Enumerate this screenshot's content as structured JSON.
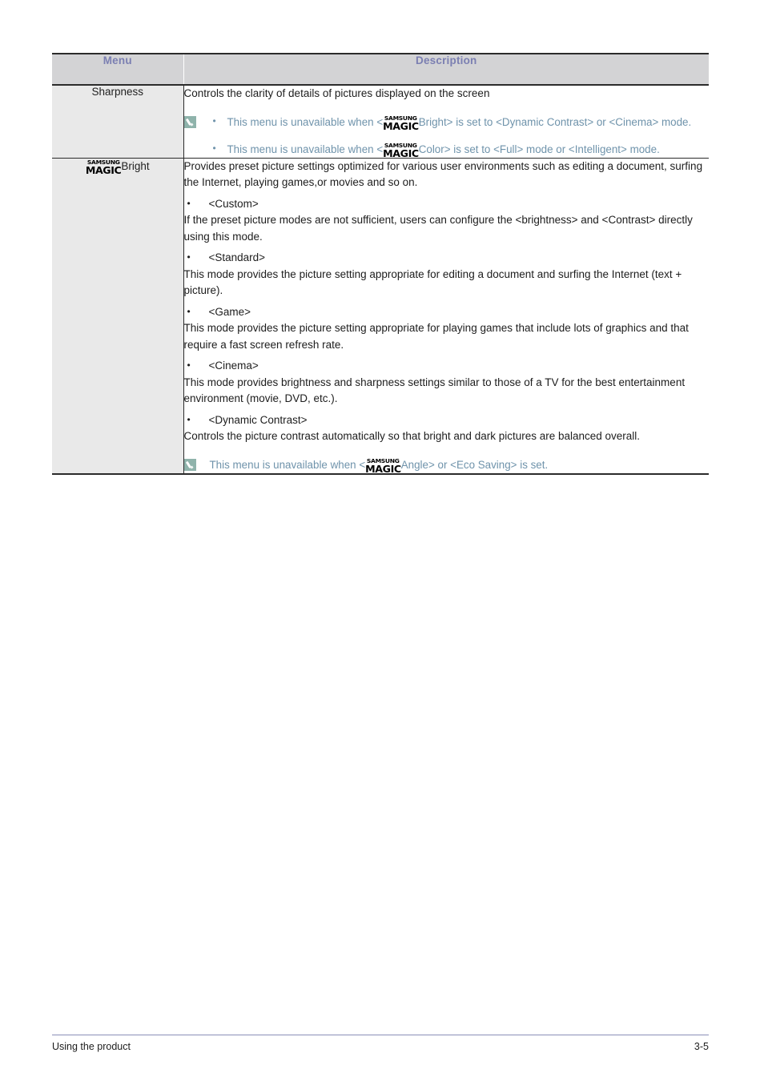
{
  "table": {
    "headers": {
      "menu": "Menu",
      "description": "Description"
    },
    "rows": [
      {
        "menu_label": "Sharpness",
        "menu_has_logo": false,
        "intro": "Controls the clarity of details of pictures displayed on the screen",
        "note_bullets": [
          {
            "pre": "This menu is unavailable when <",
            "logo": {
              "top": "SAMSUNG",
              "bottom": "MAGIC"
            },
            "post": "Bright> is set to <Dynamic Contrast> or <Cinema> mode."
          },
          {
            "pre": "This menu is unavailable when <",
            "logo": {
              "top": "SAMSUNG",
              "bottom": "MAGIC"
            },
            "post": "Color> is set to <Full> mode or <Intelligent> mode."
          }
        ]
      },
      {
        "menu_label": "Bright",
        "menu_has_logo": true,
        "menu_logo": {
          "top": "SAMSUNG",
          "bottom": "MAGIC"
        },
        "intro": "Provides preset picture settings optimized for various user environments such as editing a document, surfing the Internet, playing games,or movies and so on.",
        "items": [
          {
            "bullet": "<Custom>",
            "body": "If the preset picture modes are not sufficient, users can configure the <brightness> and <Contrast> directly using this mode."
          },
          {
            "bullet": "<Standard>",
            "body": " This mode provides the picture setting appropriate for editing a document and surfing the Internet (text + picture)."
          },
          {
            "bullet": "<Game>",
            "body": "This mode provides the picture setting appropriate for playing games that include lots of graphics and that require a fast screen refresh rate."
          },
          {
            "bullet": "<Cinema>",
            "body": "This mode provides brightness and sharpness settings similar to those of a TV for the best entertainment environment (movie, DVD, etc.)."
          },
          {
            "bullet": "<Dynamic Contrast>",
            "body": "Controls the picture contrast automatically so that bright and dark pictures are balanced overall."
          }
        ],
        "note_single": {
          "pre": "This menu is unavailable when <",
          "logo": {
            "top": "SAMSUNG",
            "bottom": "MAGIC"
          },
          "post": "Angle> or <Eco Saving> is set."
        }
      }
    ]
  },
  "footer": {
    "left": "Using the product",
    "right": "3-5"
  },
  "colors": {
    "header_text": "#7b7fb2",
    "header_bg": "#d3d3d5",
    "menu_cell_bg": "#e9e9e9",
    "note_text": "#6f93ab",
    "note_icon": "#8fb3ab",
    "footer_rule": "#8b8fb8",
    "border": "#2b2b2b"
  }
}
